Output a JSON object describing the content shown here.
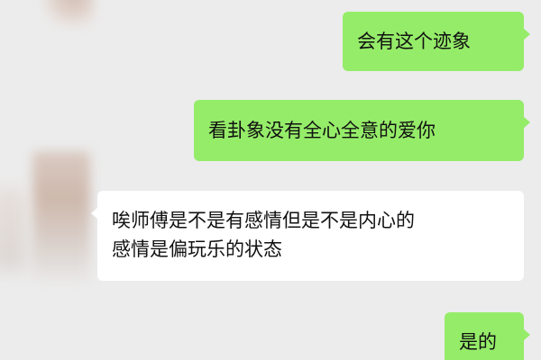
{
  "chat": {
    "messages": [
      {
        "sender": "self",
        "text": "会有这个迹象"
      },
      {
        "sender": "self",
        "text": "看卦象没有全心全意的爱你"
      },
      {
        "sender": "other",
        "lines": [
          "唉师傅是不是有感情但是不是内心的",
          "感情是偏玩乐的状态"
        ]
      },
      {
        "sender": "self",
        "text": "是的"
      }
    ]
  },
  "colors": {
    "background": "#ececec",
    "self_bubble": "#95ec69",
    "other_bubble": "#ffffff"
  }
}
